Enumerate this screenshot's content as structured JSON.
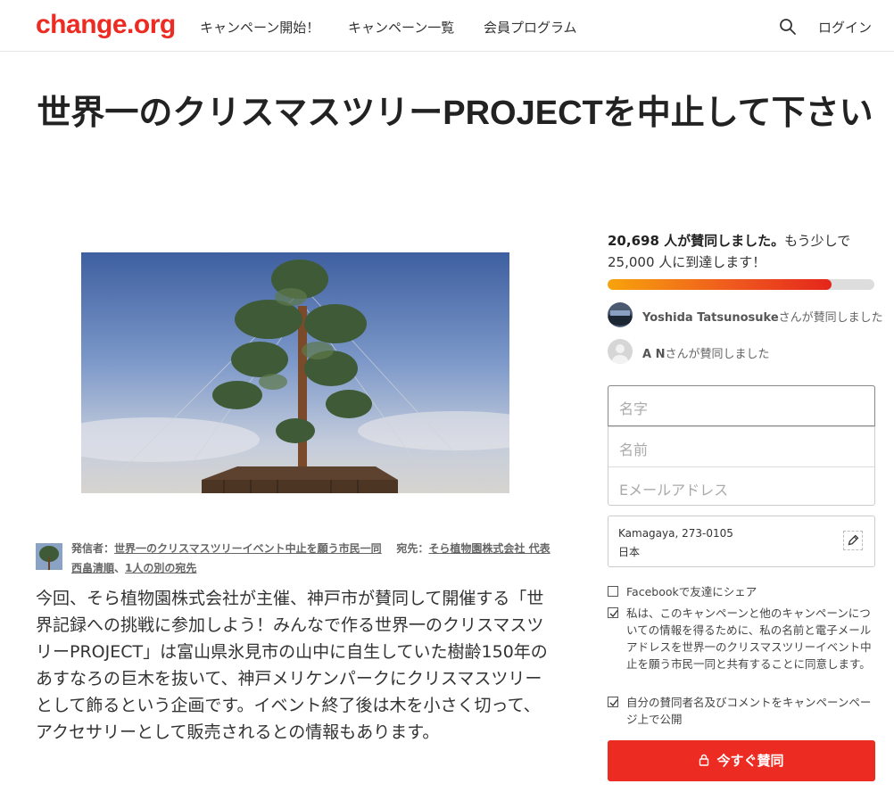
{
  "header": {
    "logo": "change.org",
    "nav": [
      "キャンペーン開始！",
      "キャンペーン一覧",
      "会員プログラム"
    ],
    "login": "ログイン"
  },
  "campaign": {
    "title": "世界一のクリスマスツリーPROJECTを中止して下さい",
    "author_label": "発信者：",
    "author": "世界一のクリスマスツリーイベント中止を願う市民一同",
    "target_label": "宛先：",
    "target": "そら植物園株式会社 代表 西畠清順",
    "other_targets": "1人の別の宛先",
    "body": "今回、そら植物園株式会社が主催、神戸市が賛同して開催する「世界記録への挑戦に参加しよう！みんなで作る世界一のクリスマスツリーPROJECT」は富山県氷見市の山中に自生していた樹齢150年のあすなろの巨木を抜いて、神戸メリケンパークにクリスマスツリーとして飾るという企画です。イベント終了後は木を小さく切って、アクセサリーとして販売されるとの情報もあります。"
  },
  "sidebar": {
    "count_bold": "20,698 人が賛同しました。",
    "count_rest": "もう少しで 25,000 人に到達します！",
    "progress": 0.84,
    "signers": [
      {
        "name": "Yoshida Tatsunosuke",
        "suffix": "さんが賛同しました"
      },
      {
        "name": "A N",
        "suffix": "さんが賛同しました"
      }
    ],
    "form": {
      "last_name": "名字",
      "first_name": "名前",
      "email": "Eメールアドレス"
    },
    "location": {
      "line1": "Kamagaya, 273-0105",
      "line2": "日本"
    },
    "checks": [
      {
        "label": "Facebookで友達にシェア",
        "checked": false
      },
      {
        "label": "私は、このキャンペーンと他のキャンペーンについての情報を得るために、私の名前と電子メールアドレスを世界一のクリスマスツリーイベント中止を願う市民一同と共有することに同意します。",
        "checked": true
      },
      {
        "label": "自分の賛同者名及びコメントをキャンペーンページ上で公開",
        "checked": true
      }
    ],
    "sign_button": "今すぐ賛同"
  },
  "colors": {
    "brand": "#ec2c22",
    "progress_start": "#f7a30c",
    "progress_end": "#e4261c"
  }
}
